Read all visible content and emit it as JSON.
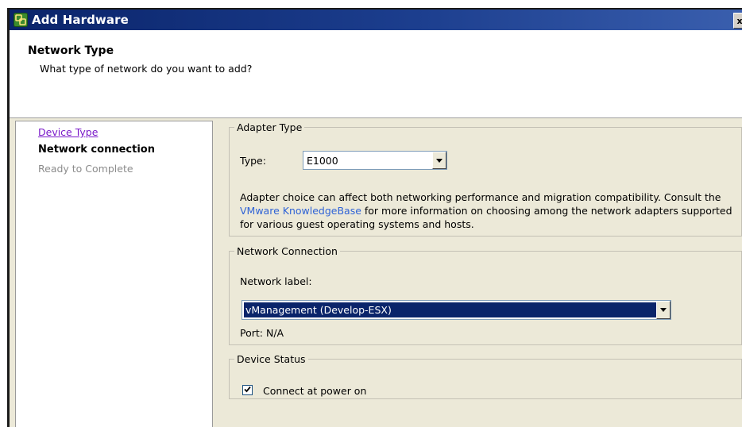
{
  "window": {
    "title": "Add Hardware",
    "close_glyph": "x"
  },
  "header": {
    "title": "Network Type",
    "subtitle": "What type of network do you want to add?"
  },
  "nav": {
    "items": [
      {
        "label": "Device Type",
        "state": "link"
      },
      {
        "label": "Network connection",
        "state": "current"
      },
      {
        "label": "Ready to Complete",
        "state": "disabled"
      }
    ]
  },
  "adapter": {
    "legend": "Adapter Type",
    "type_label": "Type:",
    "type_value": "E1000",
    "desc_before": "Adapter choice can affect both networking performance and migration compatibility. Consult the ",
    "desc_link": "VMware KnowledgeBase",
    "desc_after": " for more information on choosing among the network adapters supported for various guest operating systems and hosts."
  },
  "network_connection": {
    "legend": "Network Connection",
    "label": "Network label:",
    "value": "vManagement (Develop-ESX)",
    "port": "Port:  N/A"
  },
  "device_status": {
    "legend": "Device Status",
    "connect_label": "Connect at power on",
    "connect_checked": true
  },
  "colors": {
    "titlebar": "#0a246a",
    "dialog_bg": "#ece9d8",
    "link_visited": "#7a19c9",
    "link": "#2f63d6",
    "selection": "#0a246a"
  },
  "icons": {
    "app": "vsphere-client-icon",
    "dropdown": "chevron-down-icon",
    "check": "check-icon"
  }
}
